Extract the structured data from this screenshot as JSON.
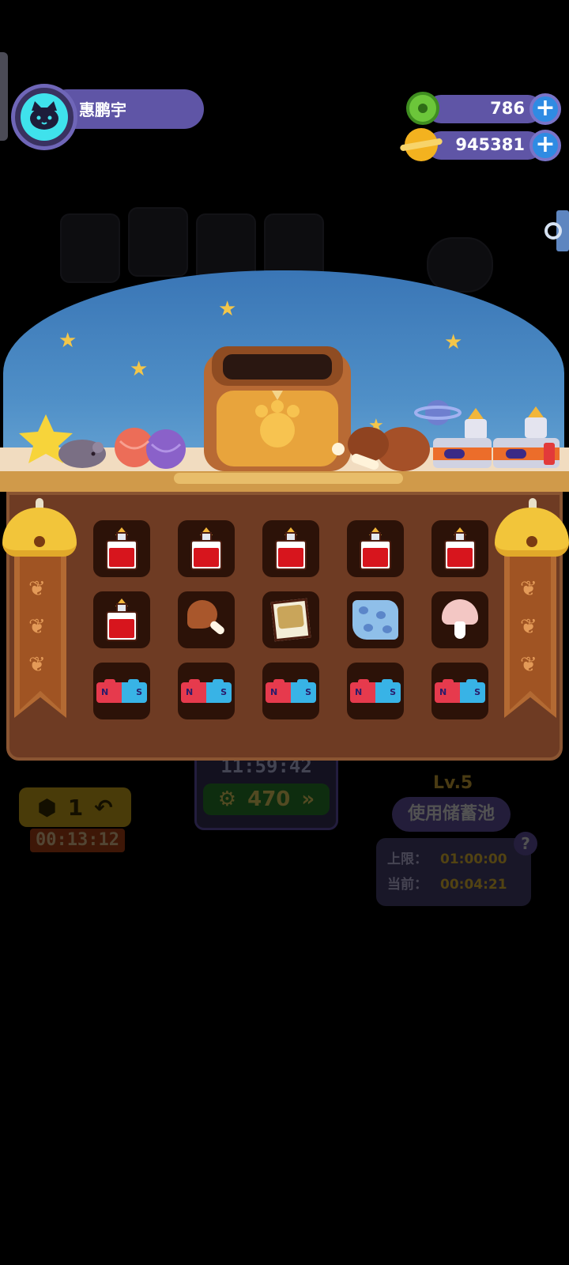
{
  "player": {
    "name": "惠鹏宇"
  },
  "currencies": [
    {
      "id": "donut",
      "value": "786",
      "icon": "green-donut-icon",
      "color": "#6cc63a"
    },
    {
      "id": "coins",
      "value": "945381",
      "icon": "gold-planet-coin-icon",
      "color": "#f3b21f"
    }
  ],
  "plus_label": "+",
  "background": {
    "timer": "11:59:42",
    "green_value": "470",
    "yellow_value": "1",
    "yellow_timer": "00:13:12",
    "level": "Lv.5",
    "use_pool_button": "使用储蓄池",
    "limit_label": "上限：",
    "limit_value": "01:00:00",
    "current_label": "当前：",
    "current_value": "00:04:21",
    "help_label": "?"
  },
  "bag": {
    "slots": [
      {
        "item": "potion"
      },
      {
        "item": "potion"
      },
      {
        "item": "potion"
      },
      {
        "item": "potion"
      },
      {
        "item": "potion"
      },
      {
        "item": "potion"
      },
      {
        "item": "drumstick"
      },
      {
        "item": "photo"
      },
      {
        "item": "cloth"
      },
      {
        "item": "mushroom"
      },
      {
        "item": "magnet"
      },
      {
        "item": "magnet"
      },
      {
        "item": "magnet"
      },
      {
        "item": "magnet"
      },
      {
        "item": "magnet"
      }
    ],
    "magnet_n": "N",
    "magnet_s": "S"
  },
  "colors": {
    "hud_bar": "#5f55a6",
    "avatar": "#3fe2ec",
    "panel": "#6e3b23",
    "slot": "#2c1208",
    "sky": "#4f8fc7"
  }
}
